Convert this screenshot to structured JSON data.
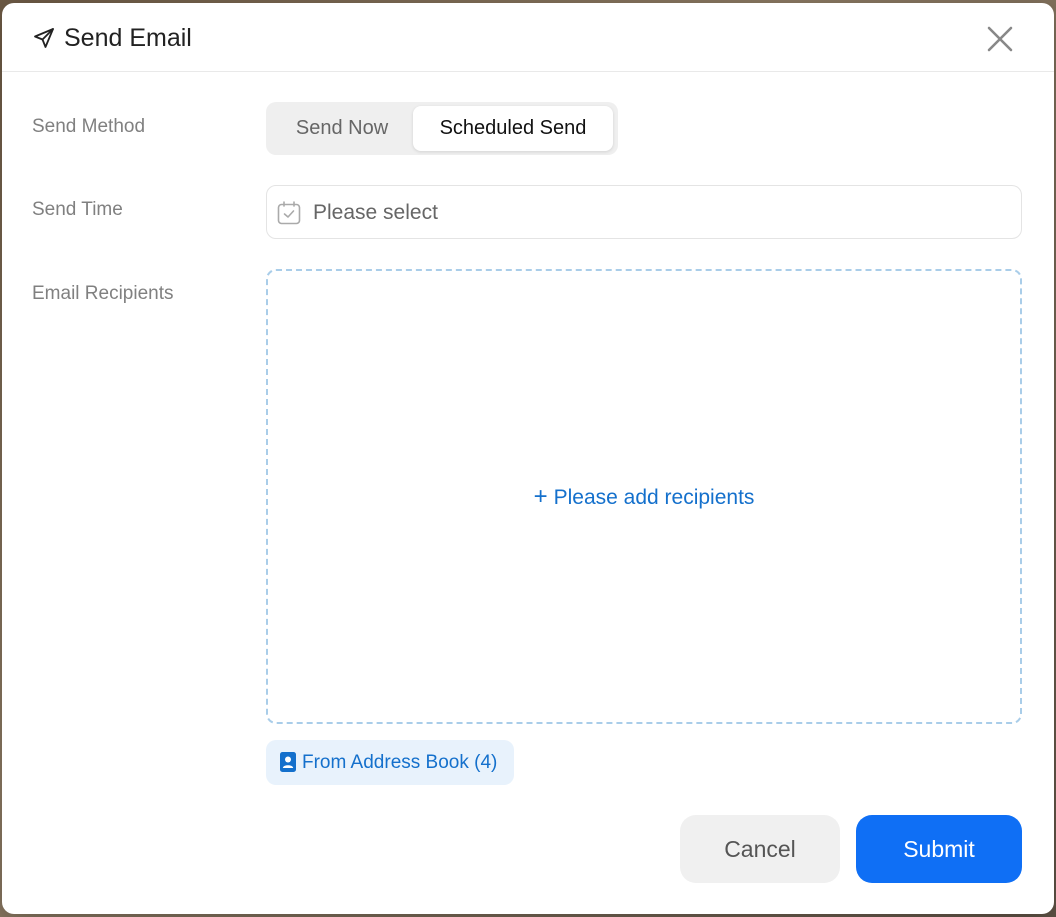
{
  "dialog": {
    "title": "Send Email",
    "header_icon": "paper-plane-icon",
    "close_icon": "close-icon"
  },
  "form": {
    "send_method": {
      "label": "Send Method",
      "options": [
        "Send Now",
        "Scheduled Send"
      ],
      "selected": "Scheduled Send"
    },
    "send_time": {
      "label": "Send Time",
      "placeholder": "Please select",
      "icon": "calendar-check-icon"
    },
    "recipients": {
      "label": "Email Recipients",
      "add_text": "Please add recipients",
      "add_icon": "plus-icon"
    },
    "address_book": {
      "label": "From Address Book (4)",
      "icon": "contact-book-icon"
    }
  },
  "footer": {
    "cancel_label": "Cancel",
    "submit_label": "Submit"
  },
  "colors": {
    "accent": "#0f6ff5",
    "link": "#1470cc",
    "dashed_border": "#a9cde9",
    "address_book_bg": "#e8f2fc"
  }
}
